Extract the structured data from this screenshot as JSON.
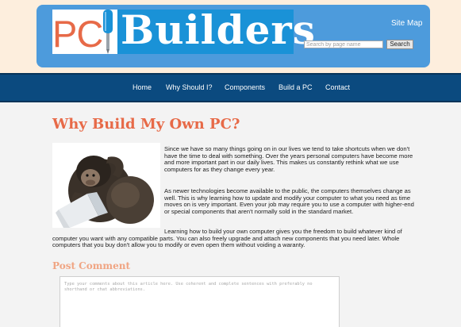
{
  "header": {
    "logo": {
      "pc": "PC",
      "builders": "Builders"
    },
    "sitemap_label": "Site Map",
    "search": {
      "placeholder": "Search by page name",
      "button_label": "Search"
    }
  },
  "nav": {
    "items": [
      {
        "label": "Home"
      },
      {
        "label": "Why Should I?"
      },
      {
        "label": "Components"
      },
      {
        "label": "Build a PC"
      },
      {
        "label": "Contact"
      }
    ]
  },
  "article": {
    "title": "Why Build My Own PC?",
    "image_icon": "monkey-with-laptop-photo",
    "paragraphs": [
      "Since we have so many things going on in our lives we tend to take shortcuts when we don't have the time to deal with something. Over the years personal computers have become more and more important part in our daily lives. This makes us constantly rethink what we use computers for as they change every year.",
      "As newer technologies become available to the public, the computers themselves change as well. This is why learning how to update and modify your computer to what you need as time moves on is very important. Even your job may require you to use a computer with higher-end or special components that aren't normally sold in the standard market.",
      "Learning how to build your own computer gives you the freedom to build whatever kind of computer you want with any compatible parts. You can also freely upgrade and attach new components that you need later. Whole computers that you buy don't allow you to modify or even open them without voiding a waranty."
    ]
  },
  "comments": {
    "title": "Post Comment",
    "placeholder": "Type your comments about this article here. Use coherent and complete sentences with preferably no shorthand or chat abbreviations."
  },
  "colors": {
    "header_blue": "#4d9bdc",
    "nav_blue": "#0b4a7f",
    "accent_orange": "#e76a48",
    "top_band": "#fdeedd"
  }
}
